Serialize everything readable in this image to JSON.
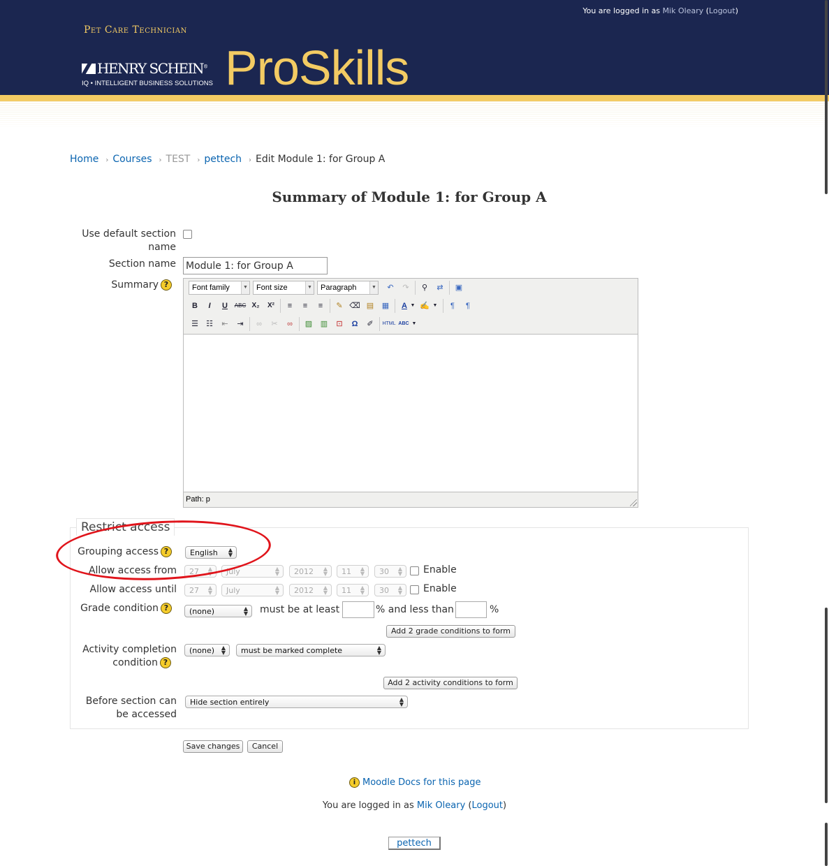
{
  "header": {
    "login_prefix": "You are logged in as ",
    "user": "Mik Oleary",
    "logout": "Logout",
    "program": "Pet Care Technician",
    "company": "HENRY SCHEIN",
    "company_mark": "®",
    "company_tagline": "IQ • INTELLIGENT BUSINESS SOLUTIONS",
    "product": "ProSkills"
  },
  "breadcrumb": {
    "home": "Home",
    "courses": "Courses",
    "test": "TEST",
    "pettech": "pettech",
    "current": "Edit Module 1: for Group A",
    "separator": "›"
  },
  "page_title": "Summary of Module 1: for Group A",
  "form": {
    "use_default_label_1": "Use default section",
    "use_default_label_2": "name",
    "section_name_label": "Section name",
    "section_name_value": "Module 1: for Group A",
    "summary_label": "Summary",
    "help_glyph": "?"
  },
  "editor": {
    "font_family": "Font family",
    "font_size": "Font size",
    "format": "Paragraph",
    "buttons": {
      "bold": "B",
      "italic": "I",
      "underline": "U",
      "strike": "ABC",
      "subscript": "X₂",
      "superscript": "X²",
      "omega": "Ω",
      "html": "HTML",
      "spellcheck": "ABC"
    },
    "path": "Path: p"
  },
  "restrict": {
    "legend": "Restrict access",
    "grouping_label": "Grouping access",
    "grouping_value": "English",
    "from_label": "Allow access from",
    "until_label": "Allow access until",
    "day": "27",
    "month": "July",
    "year": "2012",
    "hour": "11",
    "minute": "30",
    "enable": "Enable",
    "grade_label": "Grade condition",
    "grade_value": "(none)",
    "must_be_at_least": "must be at least",
    "and_less_than": "% and less than",
    "percent": "%",
    "add_grade_btn": "Add 2 grade conditions to form",
    "activity_label_1": "Activity completion",
    "activity_label_2": "condition",
    "activity_value": "(none)",
    "activity_state": "must be marked complete",
    "add_activity_btn": "Add 2 activity conditions to form",
    "before_label_1": "Before section can",
    "before_label_2": "be accessed",
    "before_value": "Hide section entirely"
  },
  "buttons": {
    "save": "Save changes",
    "cancel": "Cancel"
  },
  "footer": {
    "docs_icon": "i",
    "docs": "Moodle Docs for this page",
    "login_prefix": "You are logged in as ",
    "user": "Mik Oleary",
    "logout": "Logout",
    "course_button": "pettech"
  },
  "colors": {
    "header_bg": "#1b2650",
    "accent_gold": "#f3cb63",
    "link": "#0a64b0",
    "annotation_red": "#e0141b"
  },
  "icons": [
    "help-icon",
    "undo-icon",
    "redo-icon",
    "search-icon",
    "replace-icon",
    "fullscreen-icon",
    "cleanup-icon",
    "eraser-icon",
    "paste-icon",
    "paste-word-icon",
    "text-color-icon",
    "highlight-icon",
    "ltr-icon",
    "rtl-icon",
    "bullet-list-icon",
    "numbered-list-icon",
    "outdent-icon",
    "indent-icon",
    "link-icon",
    "unlink-icon",
    "anchor-icon",
    "image-icon",
    "media-icon",
    "nonbreaking-icon",
    "special-char-icon",
    "edit-icon",
    "info-icon"
  ]
}
